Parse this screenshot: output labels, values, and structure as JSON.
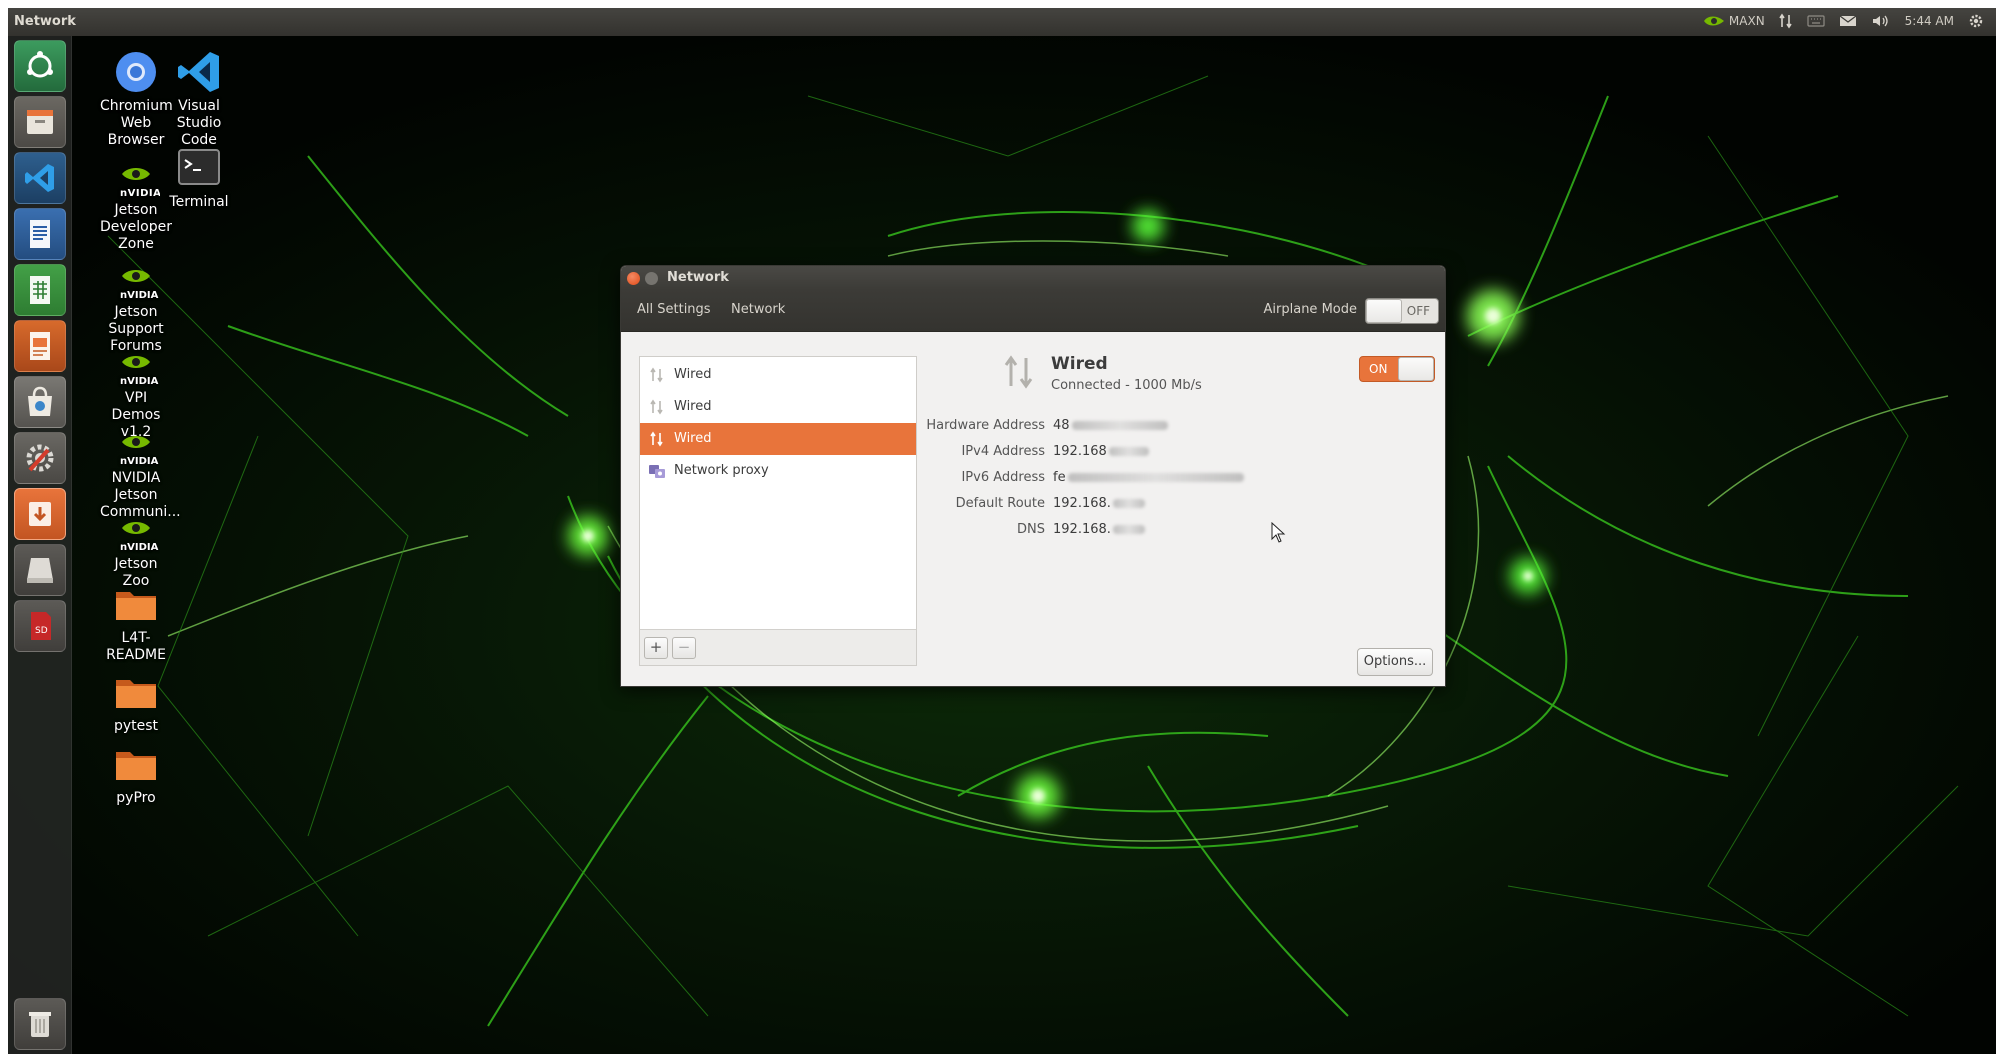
{
  "topbar": {
    "app_name": "Network",
    "power_mode": "MAXN",
    "time": "5:44 AM"
  },
  "launcher": {
    "items": [
      {
        "icon": "ubuntu-dash-icon"
      },
      {
        "icon": "files-icon"
      },
      {
        "icon": "vscode-icon"
      },
      {
        "icon": "writer-icon"
      },
      {
        "icon": "calc-icon"
      },
      {
        "icon": "impress-icon"
      },
      {
        "icon": "software-center-icon"
      },
      {
        "icon": "system-settings-icon"
      },
      {
        "icon": "software-updater-icon"
      },
      {
        "icon": "drive-icon"
      },
      {
        "icon": "sd-card-icon"
      },
      {
        "icon": "trash-icon"
      }
    ]
  },
  "desktop": {
    "chromium": "Chromium Web Browser",
    "vscode": "Visual Studio Code",
    "terminal": "Terminal",
    "jetson_dev_zone": "Jetson Developer Zone",
    "jetson_forums": "Jetson Support Forums",
    "vpi_demos": "VPI Demos v1.2",
    "jetson_community": "NVIDIA Jetson Communi...",
    "jetson_zoo": "Jetson Zoo",
    "readme": "L4T-README",
    "pytest": "pytest",
    "pypro": "pyPro",
    "nvidia_brand": "NVIDIA"
  },
  "window": {
    "title": "Network",
    "breadcrumb_all": "All Settings",
    "breadcrumb_network": "Network",
    "airplane_label": "Airplane Mode",
    "airplane_state": "OFF",
    "connections": [
      {
        "label": "Wired",
        "selected": false
      },
      {
        "label": "Wired",
        "selected": false
      },
      {
        "label": "Wired",
        "selected": true
      },
      {
        "label": "Network proxy",
        "selected": false
      }
    ],
    "add_label": "+",
    "remove_label": "−",
    "detail": {
      "title": "Wired",
      "status": "Connected - 1000 Mb/s",
      "switch_state": "ON",
      "hardware_label": "Hardware Address",
      "hardware_value": "48",
      "ipv4_label": "IPv4 Address",
      "ipv4_value": "192.168",
      "ipv6_label": "IPv6 Address",
      "ipv6_value": "fe",
      "route_label": "Default Route",
      "route_value": "192.168.",
      "dns_label": "DNS",
      "dns_value": "192.168."
    },
    "options_label": "Options..."
  },
  "colors": {
    "accent": "#e8743b",
    "panel": "#3c3b37",
    "wallpaper_glow": "#5cff3a"
  }
}
